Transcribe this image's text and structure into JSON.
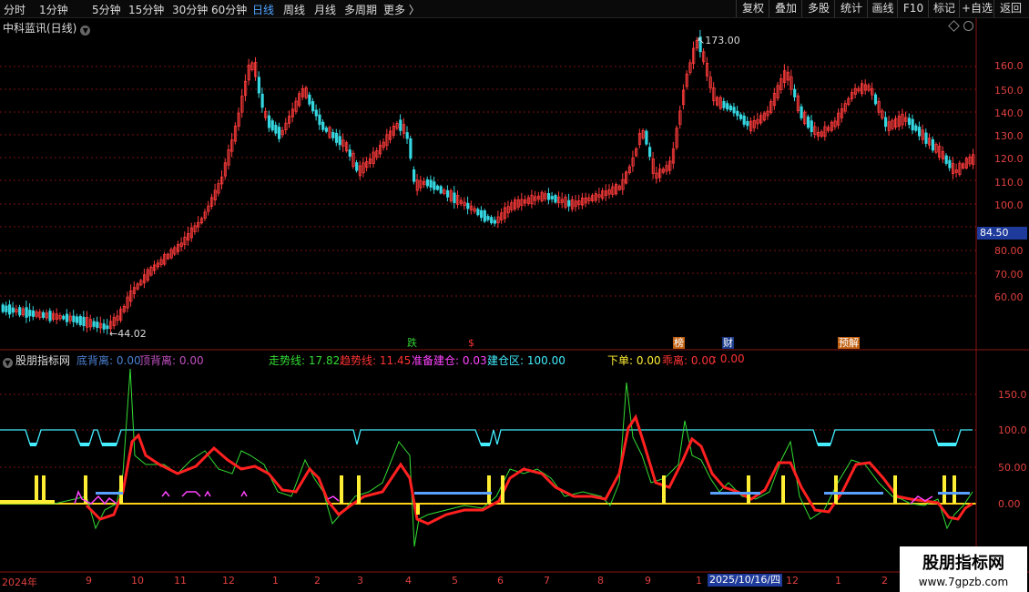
{
  "topbar": {
    "periods": [
      "分时",
      "1分钟",
      "5分钟",
      "15分钟",
      "30分钟",
      "60分钟",
      "日线",
      "周线",
      "月线",
      "多周期",
      "更多 〉"
    ],
    "active_period": "日线",
    "tools": [
      "复权",
      "叠加",
      "多股",
      "统计",
      "画线",
      "F10",
      "标记",
      "+自选",
      "返回"
    ]
  },
  "main_chart": {
    "title": "中科蓝讯(日线)",
    "yaxis_labels": [
      "160.0",
      "150.0",
      "140.0",
      "130.0",
      "120.0",
      "110.0",
      "100.0",
      "90.00",
      "80.00",
      "70.00",
      "60.00"
    ],
    "current_price": "84.50",
    "high_annotation": "173.00",
    "low_annotation": "44.02",
    "events": [
      {
        "text": "跌",
        "color": "#33cc33",
        "bg": "#000"
      },
      {
        "text": "$",
        "color": "#ff3333",
        "bg": "#000"
      },
      {
        "text": "榜",
        "color": "#ffffff",
        "bg": "#c06010"
      },
      {
        "text": "财",
        "color": "#ffffff",
        "bg": "#1a3a8a"
      },
      {
        "text": "预解",
        "color": "#ffffff",
        "bg": "#c06010"
      }
    ],
    "colors": {
      "up": "#ff3b3b",
      "down": "#35d6e0",
      "grid": "#7a1010"
    }
  },
  "indicator": {
    "name": "股朋指标网",
    "fields": [
      {
        "label": "底背离:",
        "value": "0.00",
        "color": "#4a7fd0"
      },
      {
        "label": "顶背离:",
        "value": "0.00",
        "color": "#c04fc0"
      },
      {
        "label": "走势线:",
        "value": "17.82",
        "color": "#33dd33"
      },
      {
        "label": "趋势线:",
        "value": "11.45",
        "color": "#ff3333"
      },
      {
        "label": "准备建仓:",
        "value": "0.03",
        "color": "#ff44ff"
      },
      {
        "label": "建仓区:",
        "value": "100.00",
        "color": "#44eeff"
      },
      {
        "label": "下单:",
        "value": "0.00",
        "color": "#ffee33"
      },
      {
        "label": "乖离:",
        "value": "0.00",
        "color": "#ff3333"
      },
      {
        "label": ":",
        "value": "0.00",
        "color": "#ff3333"
      }
    ],
    "yaxis_labels": [
      "150.0",
      "100.0",
      "50.00",
      "0.00"
    ]
  },
  "xaxis": {
    "labels": [
      "2024年",
      "9",
      "10",
      "11",
      "12",
      "1",
      "2",
      "3",
      "4",
      "5",
      "6",
      "7",
      "8",
      "9",
      "1",
      "12",
      "1",
      "2"
    ],
    "cursor_date": "2025/10/16/四"
  },
  "watermark": {
    "title": "股朋指标网",
    "url": "www.7gpzb.com"
  }
}
